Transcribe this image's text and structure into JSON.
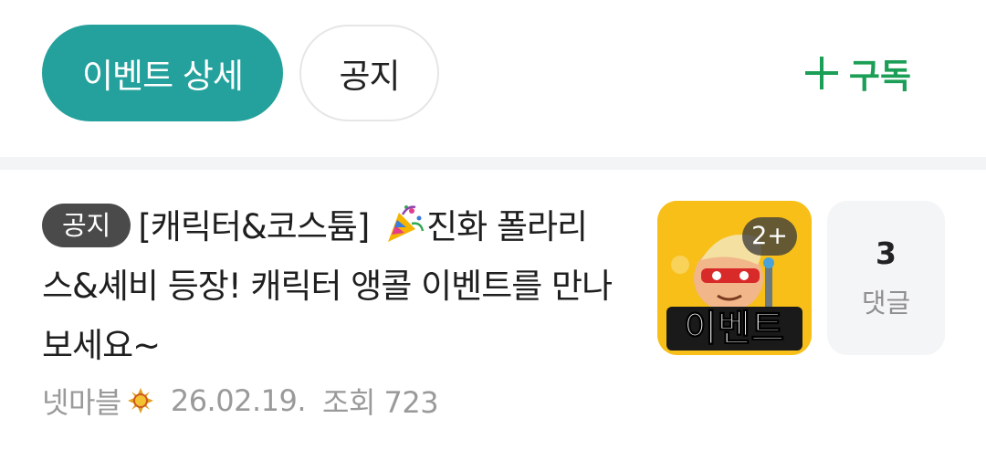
{
  "tabs": [
    {
      "label": "이벤트 상세",
      "active": true
    },
    {
      "label": "공지",
      "active": false
    }
  ],
  "subscribe": {
    "label": "구독",
    "icon": "plus-icon"
  },
  "post": {
    "badge": "공지",
    "title_part1": "[캐릭터&코스튬] ",
    "title_icon": "party-popper-icon",
    "title_part2": "진화 폴라리스&셰비 등장! 캐릭터 앵콜 이벤트를 만나보세요~",
    "author": "넷마블",
    "author_icon": "sun-badge-icon",
    "date": "26.02.19.",
    "views": "조회 723",
    "thumbnail": {
      "text": "이벤트",
      "count_badge": "2+"
    },
    "comments": {
      "count": "3",
      "label": "댓글"
    }
  },
  "colors": {
    "accent": "#24a19c",
    "subscribe": "#1b9e55",
    "thumbnail_bg": "#f7bf17"
  }
}
